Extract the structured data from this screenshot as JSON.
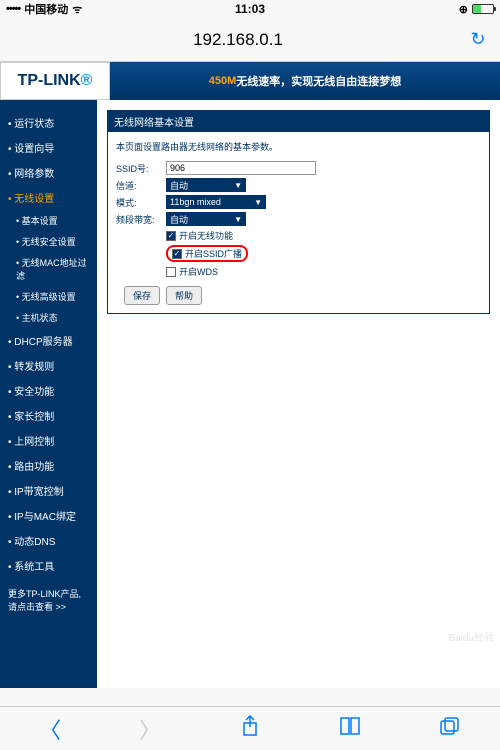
{
  "status": {
    "signal": "•••••",
    "carrier": "中国移动",
    "time": "11:03",
    "lock": "⊕"
  },
  "url": "192.168.0.1",
  "logo": {
    "text": "TP-LINK"
  },
  "banner": {
    "highlight": "450M",
    "text1": "无线速率，",
    "text2": "实现无线自由连接梦想"
  },
  "sidebar": {
    "items": [
      "运行状态",
      "设置向导",
      "网络参数",
      "无线设置"
    ],
    "subs": [
      "基本设置",
      "无线安全设置",
      "无线MAC地址过滤",
      "无线高级设置",
      "主机状态"
    ],
    "items2": [
      "DHCP服务器",
      "转发规则",
      "安全功能",
      "家长控制",
      "上网控制",
      "路由功能",
      "IP带宽控制",
      "IP与MAC绑定",
      "动态DNS",
      "系统工具"
    ],
    "footer1": "更多TP-LINK产品,",
    "footer2": "请点击查看 >>"
  },
  "panel": {
    "title": "无线网络基本设置",
    "desc": "本页面设置路由器无线网络的基本参数。",
    "ssid_label": "SSID号:",
    "ssid_value": "906",
    "channel_label": "信道:",
    "channel_value": "自动",
    "mode_label": "模式:",
    "mode_value": "11bgn mixed",
    "bandwidth_label": "频段带宽:",
    "bandwidth_value": "自动",
    "cb1": "开启无线功能",
    "cb2": "开启SSID广播",
    "cb3": "开启WDS",
    "save": "保存",
    "help": "帮助"
  },
  "watermark": "Baidu经验"
}
